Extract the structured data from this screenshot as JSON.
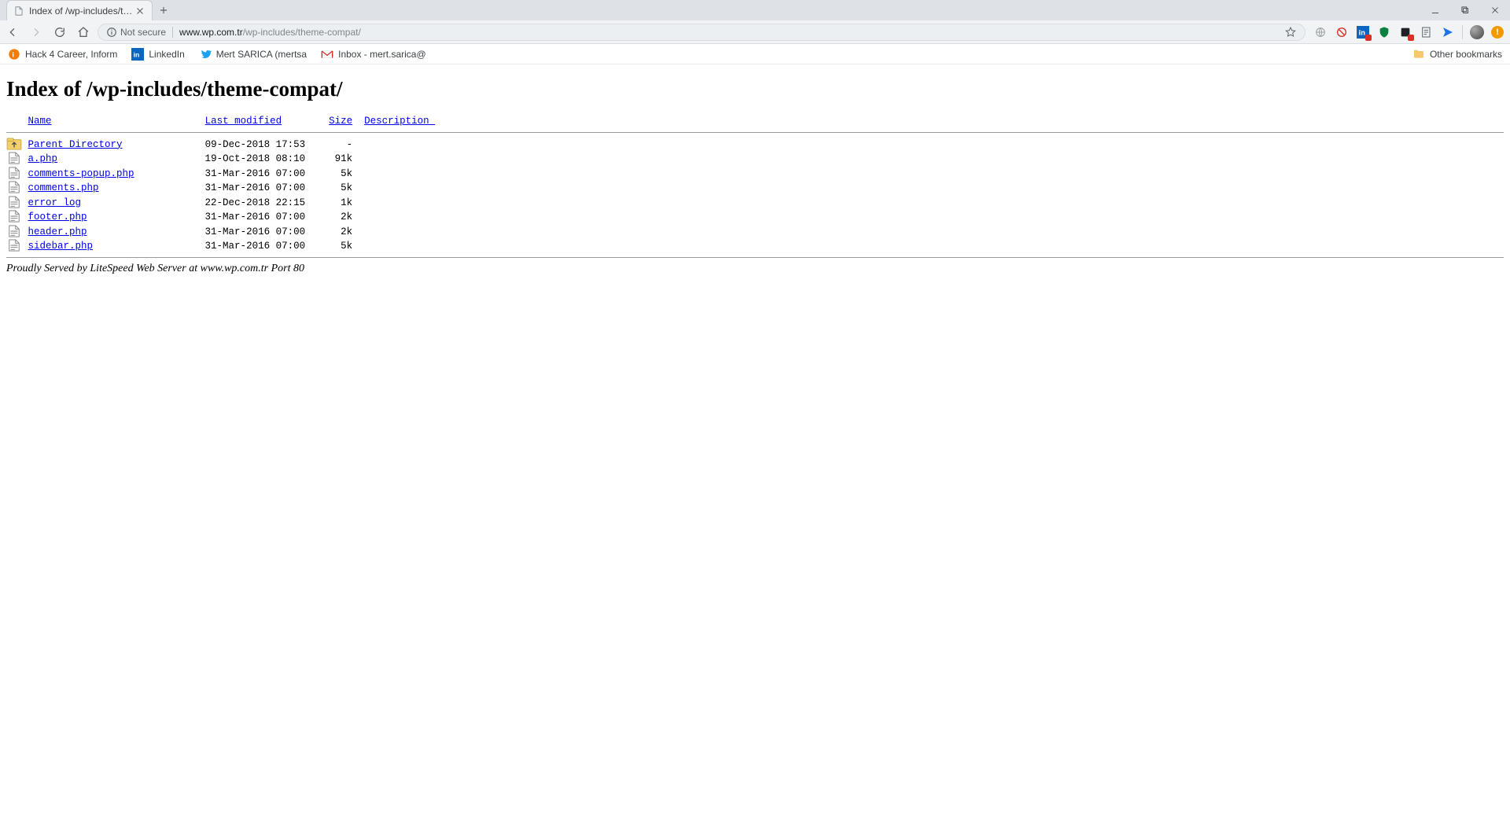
{
  "browser": {
    "tab_title": "Index of /wp-includes/theme-co",
    "not_secure_label": "Not secure",
    "url_host": "www.wp.com.tr",
    "url_path": "/wp-includes/theme-compat/",
    "bookmarks": [
      {
        "label": "Hack 4 Career, Inform",
        "icon": "orange-circle"
      },
      {
        "label": "LinkedIn",
        "icon": "linkedin"
      },
      {
        "label": "Mert SARICA (mertsa",
        "icon": "twitter"
      },
      {
        "label": "Inbox - mert.sarica@",
        "icon": "gmail"
      }
    ],
    "other_bookmarks_label": "Other bookmarks"
  },
  "page": {
    "heading": "Index of /wp-includes/theme-compat/",
    "columns": {
      "name": "Name",
      "last_modified": "Last modified",
      "size": "Size",
      "description": "Description "
    },
    "entries": [
      {
        "icon": "parent",
        "name": "Parent Directory",
        "modified": "09-Dec-2018 17:53",
        "size": "-"
      },
      {
        "icon": "file",
        "name": "a.php",
        "modified": "19-Oct-2018 08:10",
        "size": "91k"
      },
      {
        "icon": "file",
        "name": "comments-popup.php",
        "modified": "31-Mar-2016 07:00",
        "size": "5k"
      },
      {
        "icon": "file",
        "name": "comments.php",
        "modified": "31-Mar-2016 07:00",
        "size": "5k"
      },
      {
        "icon": "file",
        "name": "error_log",
        "modified": "22-Dec-2018 22:15",
        "size": "1k"
      },
      {
        "icon": "file",
        "name": "footer.php",
        "modified": "31-Mar-2016 07:00",
        "size": "2k"
      },
      {
        "icon": "file",
        "name": "header.php",
        "modified": "31-Mar-2016 07:00",
        "size": "2k"
      },
      {
        "icon": "file",
        "name": "sidebar.php",
        "modified": "31-Mar-2016 07:00",
        "size": "5k"
      }
    ],
    "footer": "Proudly Served by LiteSpeed Web Server at www.wp.com.tr Port 80"
  }
}
